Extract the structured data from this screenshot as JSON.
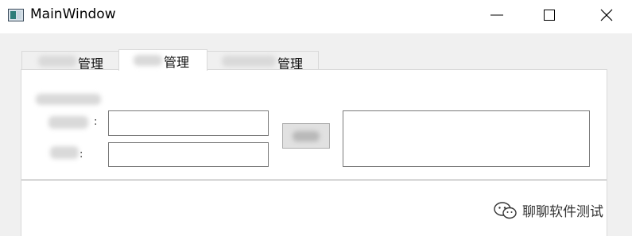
{
  "window": {
    "title": "MainWindow",
    "controls": [
      "minimize-icon",
      "maximize-icon",
      "close-icon"
    ]
  },
  "tabs": [
    {
      "label": "管理",
      "active": false
    },
    {
      "label": "管理",
      "active": true
    },
    {
      "label": "管理",
      "active": false
    }
  ],
  "form": {
    "colon": ":",
    "field_1_value": "",
    "field_2_value": ""
  },
  "watermark": {
    "icon": "wechat-icon",
    "text": "聊聊软件测试"
  }
}
